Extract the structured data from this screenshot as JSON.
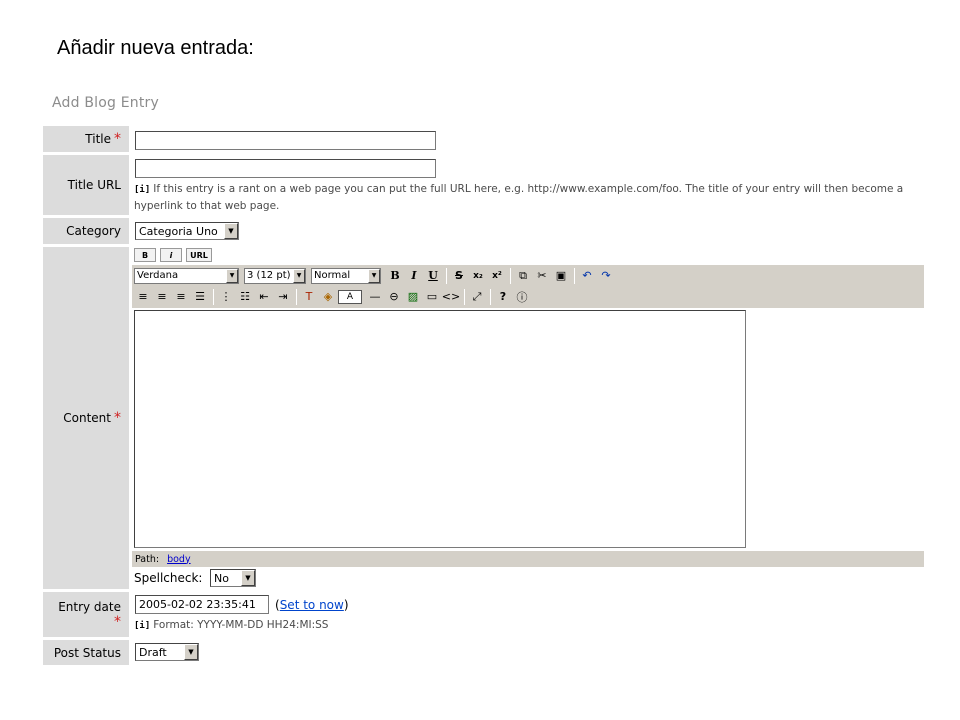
{
  "slide_title": "Añadir nueva entrada:",
  "form_heading": "Add Blog Entry",
  "fields": {
    "title": {
      "label": "Title",
      "required_mark": "*",
      "value": ""
    },
    "title_url": {
      "label": "Title URL",
      "value": "",
      "hint_icon": "[i]",
      "hint_line1": "If this entry is a rant on a web page you can put the full URL here, e.g. http://www.example.com/foo. The title of your entry will then become a",
      "hint_line2": "hyperlink to that web page."
    },
    "category": {
      "label": "Category",
      "selected": "Categoria Uno"
    },
    "content": {
      "label": "Content",
      "required_mark": "*",
      "mode_buttons": [
        "B",
        "i",
        "URL"
      ],
      "font_select": "Verdana",
      "size_select": "3 (12 pt)",
      "format_select": "Normal",
      "color_box_label": "A",
      "path_label": "Path:",
      "path_link": "body",
      "spellcheck_label": "Spellcheck:",
      "spellcheck_selected": "No"
    },
    "entry_date": {
      "label": "Entry date",
      "required_mark": "*",
      "value": "2005-02-02 23:35:41",
      "paren_open": "(",
      "set_now_link": "Set to now",
      "paren_close": ")",
      "hint_icon": "[i]",
      "hint": "Format: YYYY-MM-DD HH24:MI:SS"
    },
    "post_status": {
      "label": "Post Status",
      "selected": "Draft"
    }
  },
  "toolbar_icons": {
    "row1": [
      "bold-icon",
      "italic-icon",
      "underline-icon",
      "strikethrough-icon",
      "subscript-icon",
      "superscript-icon",
      "copy-icon",
      "cut-icon",
      "paste-icon",
      "undo-icon",
      "redo-icon"
    ],
    "row2": [
      "align-left-icon",
      "align-center-icon",
      "align-right-icon",
      "align-justify-icon",
      "ordered-list-icon",
      "unordered-list-icon",
      "outdent-icon",
      "indent-icon",
      "text-color-icon",
      "background-color-icon",
      "horizontal-rule-icon",
      "link-icon",
      "image-icon",
      "table-icon",
      "html-source-icon",
      "fullscreen-icon",
      "help-icon",
      "about-icon"
    ]
  }
}
